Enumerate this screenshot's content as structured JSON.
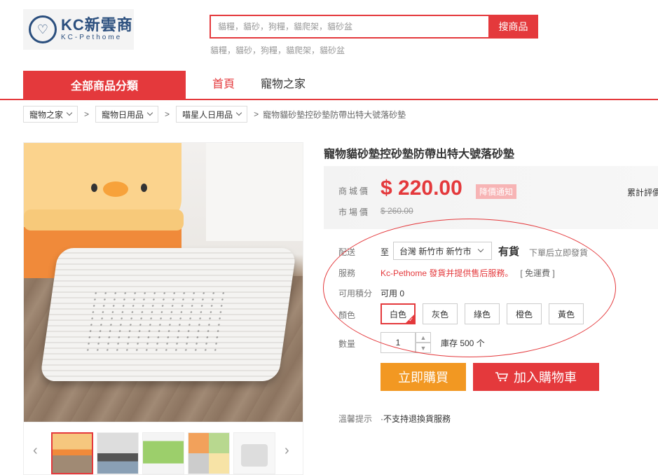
{
  "header": {
    "logo_title": "KC新雲商",
    "logo_sub": "KC-Pethome",
    "search_placeholder": "貓糧，貓砂，狗糧，貓爬架，貓砂盆",
    "search_button": "搜商品",
    "hot_words": "貓糧，貓砂，狗糧，貓爬架，貓砂盆"
  },
  "nav": {
    "all_categories": "全部商品分類",
    "items": [
      "首頁",
      "寵物之家"
    ]
  },
  "breadcrumb": {
    "items": [
      "寵物之家",
      "寵物日用品",
      "喵星人日用品"
    ],
    "current": "寵物貓砂墊控砂墊防帶出特大號落砂墊"
  },
  "product": {
    "title": "寵物貓砂墊控砂墊防帶出特大號落砂墊",
    "price_label": "商城價",
    "price": "$ 220.00",
    "price_notice": "降價通知",
    "market_label": "市場價",
    "market_price": "$ 260.00",
    "review_label": "累計評價",
    "shipping_label": "配送",
    "ship_to": "至",
    "region": "台灣 新竹市 新竹市",
    "stock_status": "有貨",
    "stock_note": "下單后立即發貨",
    "service_label": "服務",
    "service_text": "Kc-Pethome 發貨并提供售后服務。",
    "free_shipping": "[ 免運費 ]",
    "points_label": "可用積分",
    "points_value": "可用 0",
    "color_label": "顏色",
    "colors": [
      "白色",
      "灰色",
      "綠色",
      "橙色",
      "黃色"
    ],
    "qty_label": "數量",
    "qty_value": "1",
    "inventory": "庫存 500 个",
    "buy_now": "立即購買",
    "add_to_cart": "加入購物車",
    "tips_label": "溫馨提示",
    "tips_text": "·不支持退換貨服務"
  },
  "colors": {
    "accent": "#e4393c",
    "buy_now": "#f29822"
  }
}
